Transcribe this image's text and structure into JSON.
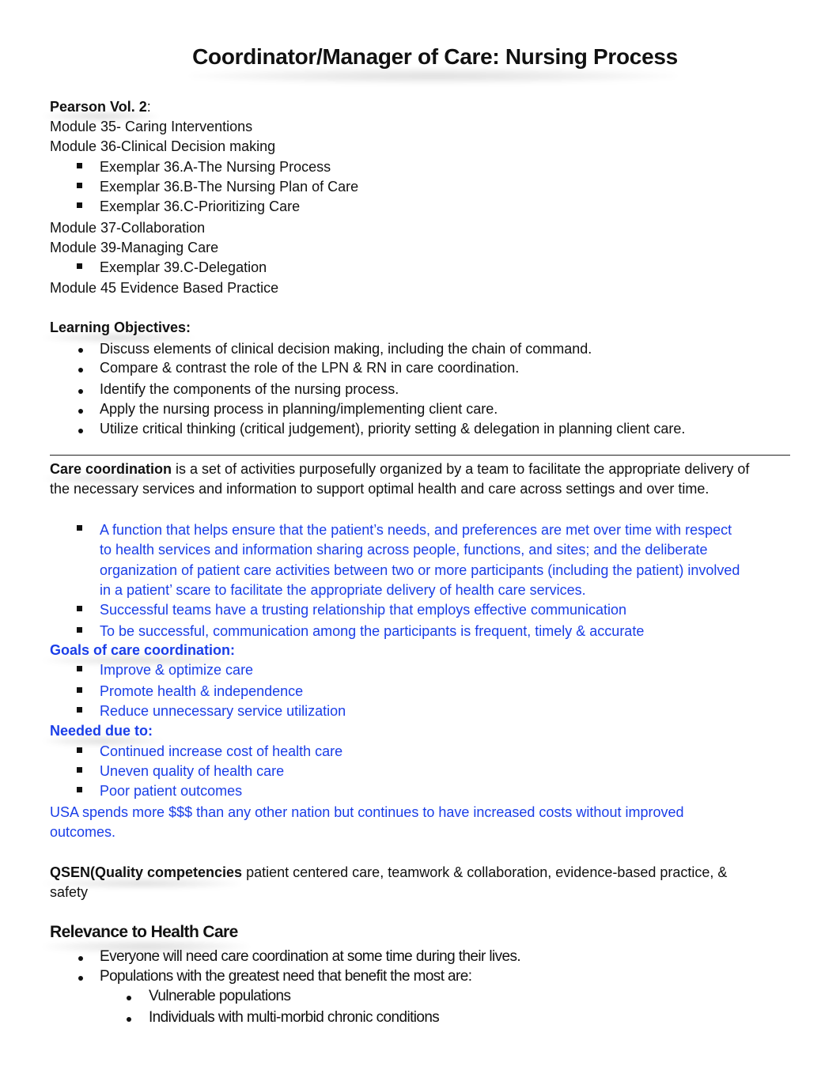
{
  "title": "Coordinator/Manager of Care: Nursing Process",
  "readings": {
    "heading": "Pearson Vol. 2",
    "heading_suffix": ":",
    "items": [
      {
        "level": 0,
        "text": "Module 35- Caring Interventions"
      },
      {
        "level": 0,
        "text": "Module 36-Clinical Decision making"
      },
      {
        "level": 1,
        "text": "Exemplar 36.A-The Nursing Process"
      },
      {
        "level": 1,
        "text": "Exemplar 36.B-The Nursing Plan of Care"
      },
      {
        "level": 1,
        "text": "Exemplar 36.C-Prioritizing Care"
      },
      {
        "level": 0,
        "text": "Module 37-Collaboration"
      },
      {
        "level": 0,
        "text": "Module 39-Managing Care"
      },
      {
        "level": 1,
        "text": "Exemplar 39.C-Delegation"
      },
      {
        "level": 0,
        "text": "Module 45 Evidence Based Practice"
      }
    ]
  },
  "objectives": {
    "heading": "Learning Objectives:",
    "items": [
      "Discuss elements of clinical decision making, including the chain of command.",
      "Compare & contrast the role of the LPN & RN in care coordination.",
      "Identify the components of the nursing process.",
      "Apply the nursing process in planning/implementing client care.",
      "Utilize critical thinking (critical judgement), priority setting & delegation in planning client care."
    ]
  },
  "care_coordination": {
    "term": "Care coordination",
    "definition_line1": " is a set of activities purposefully organized by a team to facilitate the appropriate delivery of",
    "definition_line2": "the necessary services and information to support optimal health and care across settings and over time.",
    "bullets": [
      {
        "lines": [
          "A function that helps ensure that the patient’s needs, and preferences are met over time with respect",
          "to health services and information sharing across people, functions, and sites; and the deliberate",
          "organization of patient care activities between two or more participants (including the patient) involved",
          "in a patient’ scare to facilitate the appropriate delivery of health care services."
        ]
      },
      {
        "lines": [
          "Successful teams have a trusting relationship that employs effective communication"
        ]
      },
      {
        "lines": [
          "To be successful, communication among the participants is frequent, timely & accurate"
        ]
      }
    ]
  },
  "goals": {
    "heading": "Goals of care coordination:",
    "items": [
      "Improve & optimize care",
      "Promote health & independence",
      "Reduce unnecessary service utilization"
    ]
  },
  "needed": {
    "heading": "Needed due to:",
    "items": [
      "Continued increase cost of health care",
      "Uneven quality of health care",
      "Poor patient outcomes"
    ]
  },
  "usa_note": {
    "line1": "USA spends more $$$ than any other nation but continues to have increased costs without improved",
    "line2": "outcomes."
  },
  "qsen": {
    "label": "QSEN(Quality competencies",
    "text_line1": " patient centered care, teamwork & collaboration, evidence-based practice, &",
    "text_line2": "safety"
  },
  "relevance": {
    "heading": "Relevance to Health Care",
    "items": [
      "Everyone will need care coordination at some time during their lives.",
      "Populations with the greatest need that benefit the most are:"
    ],
    "subitems": [
      "Vulnerable populations",
      "Individuals with multi-morbid chronic conditions"
    ]
  },
  "colors": {
    "accent_blue": "#1a3ee8",
    "text": "#111111"
  }
}
